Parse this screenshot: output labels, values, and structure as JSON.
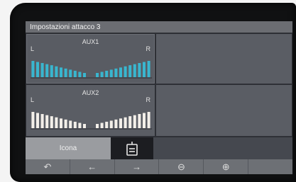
{
  "window": {
    "title": "Impostazioni attacco 3"
  },
  "channels": [
    {
      "name": "AUX1",
      "left_label": "L",
      "right_label": "R",
      "bar_color": "#39b6cf",
      "level_left_fraction": 1.0,
      "level_right_fraction": 1.0,
      "selected": true
    },
    {
      "name": "AUX2",
      "left_label": "L",
      "right_label": "R",
      "bar_color": "#f3efe9",
      "level_left_fraction": 1.0,
      "level_right_fraction": 1.0,
      "selected": false
    }
  ],
  "icon_row": {
    "label": "Icona",
    "icon": "tractor-attachment-icon"
  },
  "nav": {
    "buttons": [
      {
        "name": "back",
        "glyph": "↶"
      },
      {
        "name": "left-arrow",
        "glyph": "←"
      },
      {
        "name": "right-arrow",
        "glyph": "→"
      },
      {
        "name": "minus",
        "glyph": "⊖"
      },
      {
        "name": "plus",
        "glyph": "⊕"
      },
      {
        "name": "empty",
        "glyph": ""
      }
    ]
  }
}
